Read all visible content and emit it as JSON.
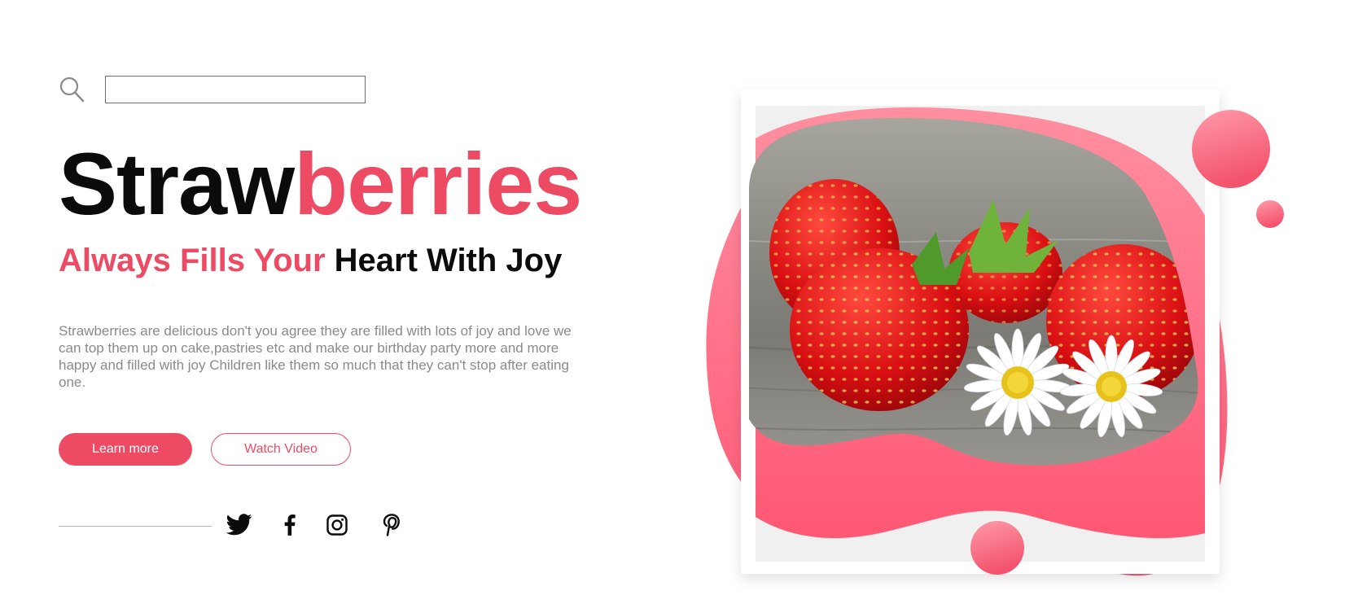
{
  "search": {
    "placeholder": "",
    "value": "",
    "icon": "search-icon"
  },
  "hero": {
    "title_part1": "Straw",
    "title_part2": "berries",
    "subtitle_part1": "Always Fills Your",
    "subtitle_part2": "Heart With Joy",
    "description": "Strawberries are delicious don't you agree they are filled with lots of joy and love we can top them up on cake,pastries etc and make our birthday party more and more happy and filled with joy Children like them so much that they can't stop after eating one."
  },
  "buttons": {
    "learn_more": "Learn more",
    "watch_video": "Watch Video"
  },
  "social": [
    {
      "name": "twitter",
      "icon": "twitter-icon"
    },
    {
      "name": "facebook",
      "icon": "facebook-icon"
    },
    {
      "name": "instagram",
      "icon": "instagram-icon"
    },
    {
      "name": "pinterest",
      "icon": "pinterest-icon"
    }
  ],
  "image": {
    "subject": "strawberries-with-daisies"
  },
  "colors": {
    "accent": "#ec4b63",
    "text_dark": "#0b0b0b",
    "text_muted": "#8a8a8a",
    "border": "#6f6f6f"
  }
}
